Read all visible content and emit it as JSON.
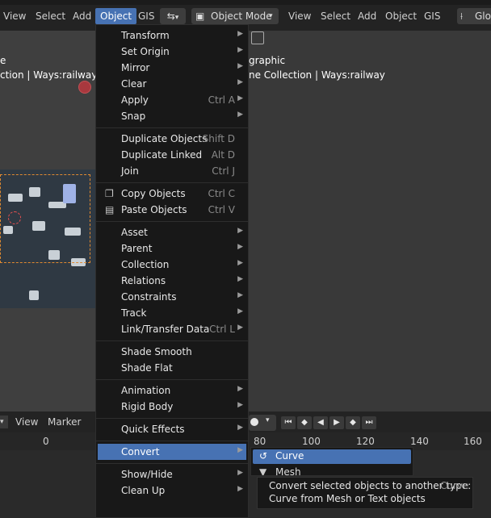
{
  "header": {
    "menus": [
      "View",
      "Select",
      "Add",
      "Object",
      "GIS"
    ],
    "mode": "Object Mode",
    "right_menus": [
      "View",
      "Select",
      "Add",
      "Object",
      "GIS"
    ],
    "global": "Glo"
  },
  "viewport": {
    "left_line1": "e",
    "left_line2": "ction | Ways:railway",
    "right_line1": "graphic",
    "right_line2": "ne Collection | Ways:railway"
  },
  "timeline": {
    "menus": [
      "View",
      "Marker"
    ],
    "ticks": [
      "0",
      "80",
      "100",
      "120",
      "140",
      "160"
    ]
  },
  "object_menu": {
    "groups": [
      [
        {
          "label": "Transform",
          "shortcut": "",
          "arrow": true
        },
        {
          "label": "Set Origin",
          "shortcut": "",
          "arrow": true
        },
        {
          "label": "Mirror",
          "shortcut": "",
          "arrow": true
        },
        {
          "label": "Clear",
          "shortcut": "",
          "arrow": true
        },
        {
          "label": "Apply",
          "shortcut": "Ctrl A",
          "arrow": true
        },
        {
          "label": "Snap",
          "shortcut": "",
          "arrow": true
        }
      ],
      [
        {
          "label": "Duplicate Objects",
          "shortcut": "Shift D",
          "arrow": false
        },
        {
          "label": "Duplicate Linked",
          "shortcut": "Alt D",
          "arrow": false
        },
        {
          "label": "Join",
          "shortcut": "Ctrl J",
          "arrow": false
        }
      ],
      [
        {
          "label": "Copy Objects",
          "shortcut": "Ctrl C",
          "arrow": false,
          "icon": "copy-icon"
        },
        {
          "label": "Paste Objects",
          "shortcut": "Ctrl V",
          "arrow": false,
          "icon": "paste-icon"
        }
      ],
      [
        {
          "label": "Asset",
          "shortcut": "",
          "arrow": true
        },
        {
          "label": "Parent",
          "shortcut": "",
          "arrow": true
        },
        {
          "label": "Collection",
          "shortcut": "",
          "arrow": true
        },
        {
          "label": "Relations",
          "shortcut": "",
          "arrow": true
        },
        {
          "label": "Constraints",
          "shortcut": "",
          "arrow": true
        },
        {
          "label": "Track",
          "shortcut": "",
          "arrow": true
        },
        {
          "label": "Link/Transfer Data",
          "shortcut": "Ctrl L",
          "arrow": true
        }
      ],
      [
        {
          "label": "Shade Smooth",
          "shortcut": "",
          "arrow": false
        },
        {
          "label": "Shade Flat",
          "shortcut": "",
          "arrow": false
        }
      ],
      [
        {
          "label": "Animation",
          "shortcut": "",
          "arrow": true
        },
        {
          "label": "Rigid Body",
          "shortcut": "",
          "arrow": true
        }
      ],
      [
        {
          "label": "Quick Effects",
          "shortcut": "",
          "arrow": true
        }
      ],
      [
        {
          "label": "Convert",
          "shortcut": "",
          "arrow": true,
          "highlighted": true
        }
      ],
      [
        {
          "label": "Show/Hide",
          "shortcut": "",
          "arrow": true
        },
        {
          "label": "Clean Up",
          "shortcut": "",
          "arrow": true
        }
      ]
    ]
  },
  "convert_submenu": {
    "items": [
      "Curve",
      "Mesh"
    ]
  },
  "tooltip": {
    "line1": "Convert selected objects to another type:",
    "line1_value": "Curve",
    "line2": "Curve from Mesh or Text objects"
  }
}
